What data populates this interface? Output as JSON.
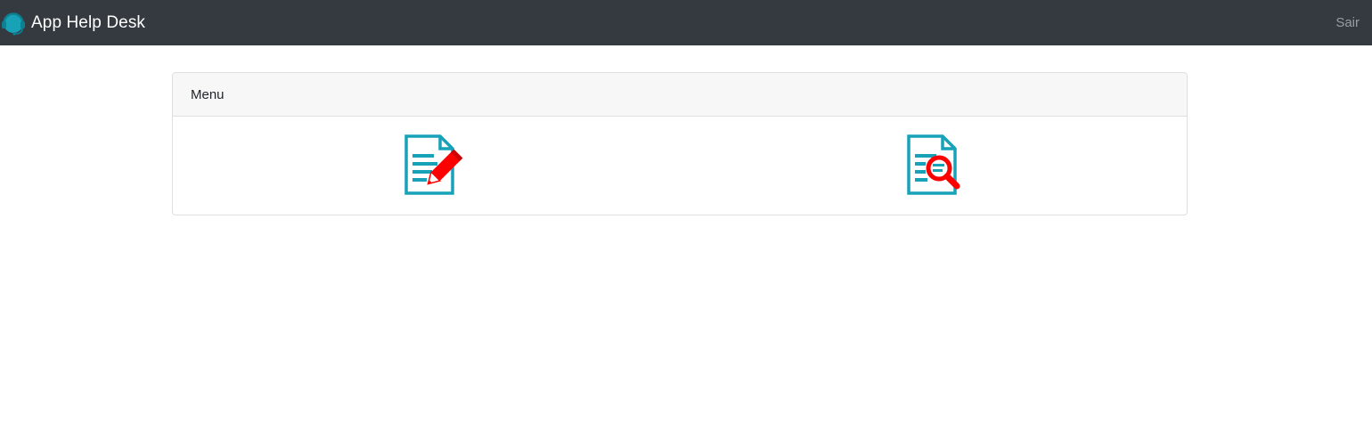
{
  "navbar": {
    "brand_text": "App Help Desk",
    "brand_icon": "headset-icon",
    "logout_label": "Sair"
  },
  "menu": {
    "title": "Menu",
    "items": [
      {
        "icon": "document-edit-icon",
        "action": "open-ticket"
      },
      {
        "icon": "document-search-icon",
        "action": "query-ticket"
      }
    ]
  },
  "colors": {
    "navbar_bg": "#343a40",
    "accent": "#17a2b8",
    "icon_red": "#ff0000",
    "card_header_bg": "#f7f7f7"
  }
}
